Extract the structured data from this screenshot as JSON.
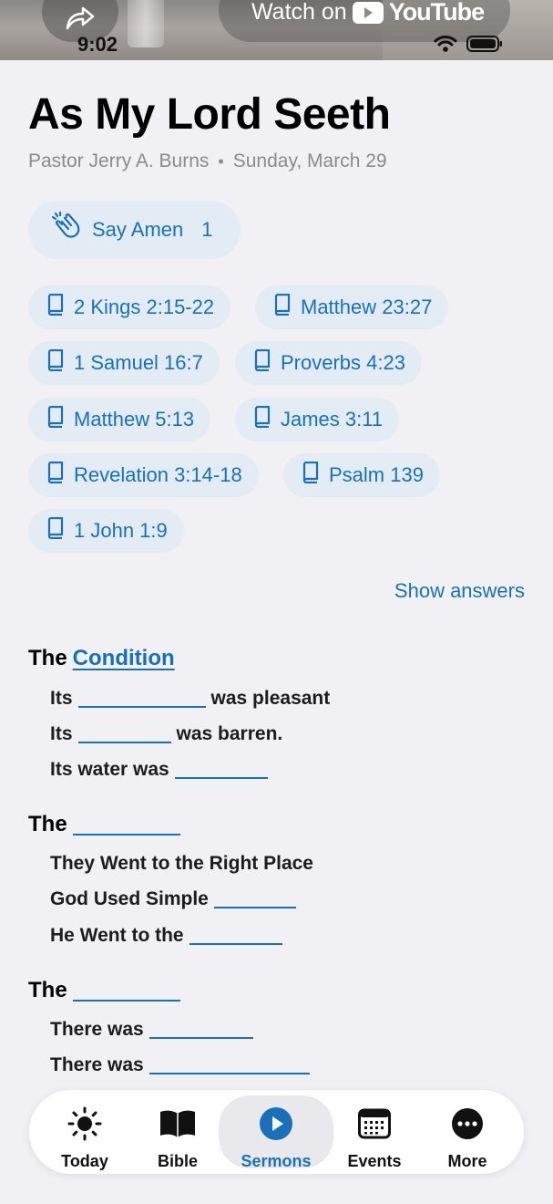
{
  "video": {
    "watch_label": "Watch on",
    "brand": "YouTube"
  },
  "status_bar": {
    "time": "9:02"
  },
  "sermon": {
    "title": "As My Lord Seeth",
    "pastor": "Pastor Jerry A. Burns",
    "separator": "•",
    "date": "Sunday, March 29"
  },
  "amen": {
    "label": "Say Amen",
    "count": "1"
  },
  "scriptures": [
    "2 Kings 2:15-22",
    "Matthew 23:27",
    "1 Samuel 16:7",
    "Proverbs 4:23",
    "Matthew 5:13",
    "James 3:11",
    "Revelation 3:14-18",
    "Psalm 139",
    "1 John 1:9"
  ],
  "show_answers_label": "Show answers",
  "outline": {
    "section1": {
      "prefix": "The",
      "link": "Condition",
      "lines": [
        {
          "before": "Its",
          "after": "was pleasant"
        },
        {
          "before": "Its",
          "after": "was barren."
        },
        {
          "before": "Its water was",
          "after": ""
        }
      ]
    },
    "section2": {
      "prefix": "The",
      "lines": [
        {
          "before": "They Went to the Right Place",
          "after": ""
        },
        {
          "before": "God Used Simple",
          "after": ""
        },
        {
          "before": "He Went to the",
          "after": ""
        }
      ]
    },
    "section3": {
      "prefix": "The",
      "lines": [
        {
          "before": "There was",
          "after": ""
        },
        {
          "before": "There was",
          "after": ""
        }
      ]
    }
  },
  "tabbar": {
    "today": "Today",
    "bible": "Bible",
    "sermons": "Sermons",
    "events": "Events",
    "more": "More"
  },
  "colors": {
    "accent": "#1a70b8",
    "pill_bg": "#e3ecf4",
    "background": "#f1f0f5"
  }
}
